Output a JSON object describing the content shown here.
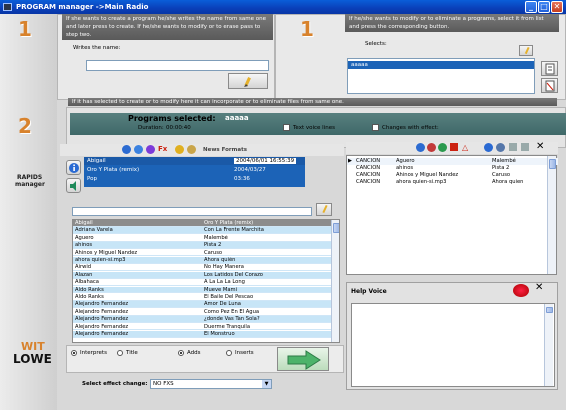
{
  "window": {
    "title": "PROGRAM manager   ->Main Radio"
  },
  "sidebar": {
    "step1": "1",
    "step2": "2",
    "brand_line1": "RAPIDS",
    "brand_line2": "manager",
    "logo_line1": "WIT",
    "logo_line2": "LOWE"
  },
  "step1_right_num": "1",
  "create_panel": {
    "instruction": "If she wants to create a program he/she writes the name from same one and later press to create. If he/she wants to modify or to erase pass to step two.",
    "name_label": "Writes the name:",
    "name_value": ""
  },
  "modify_panel": {
    "instruction": "If he/she wants to modify or to eliminate a programs, select it from list and press the corresponding button.",
    "selects_label": "Selects:",
    "selected_item": "aaaaa"
  },
  "step2_instruction": "If it has selected to create or to modify here it can incorporate or to eliminate files from same one.",
  "program_bar": {
    "title": "Programs selected:",
    "value": "aaaaa",
    "duration_label": "Duration:",
    "duration_value": "00:00:40",
    "text_voice_label": "Text voice lines",
    "changes_label": "Changes with effect:"
  },
  "library_toolbar": {
    "label": "News Formats",
    "fx_label": "Fx"
  },
  "track_info": {
    "rows": [
      {
        "title": "Abigail",
        "date": "2004/06/01 16:55:39"
      },
      {
        "title": "Oro Y Plata (remix)",
        "date": "2004/03/27"
      },
      {
        "title": "Pop",
        "date": "03:36"
      }
    ]
  },
  "filter": {
    "value": ""
  },
  "tracks": {
    "header": [
      "Abigail",
      "Oro Y Plata (remix)"
    ],
    "rows": [
      [
        "Adriana Varela",
        "Con La Frente Marchita"
      ],
      [
        "Aguero",
        "Malembé"
      ],
      [
        "ahinos",
        "Pista 2"
      ],
      [
        "Ahinos y Miguel Nandez",
        "Caruso"
      ],
      [
        "ahora quien-si.mp3",
        "Ahora quién"
      ],
      [
        "Airwid",
        "No Hay Manera"
      ],
      [
        "Alazan",
        "Los Latidos Del Corazo"
      ],
      [
        "Albahaca",
        "A La La La Long"
      ],
      [
        "Aldo Ranks",
        "Mueve Mami"
      ],
      [
        "Aldo Ranks",
        "El Baile Del Pescao"
      ],
      [
        "Alejandro Fernandez",
        "Amor De Luna"
      ],
      [
        "Alejandro Fernandez",
        "Como Pez En El Agua"
      ],
      [
        "Alejandro Fernandez",
        "¿donde Vas Tan Sola?"
      ],
      [
        "Alejandro Fernandez",
        "Duerme Tranquila"
      ],
      [
        "Alejandro Fernandez",
        "El Monstruo"
      ]
    ]
  },
  "playlist": {
    "rows": [
      [
        "CANCION",
        "Aguero",
        "Malembé"
      ],
      [
        "CANCION",
        "ahinos",
        "Pista 2"
      ],
      [
        "CANCION",
        "Ahinos y Miguel Nandez",
        "Caruso"
      ],
      [
        "CANCION",
        "ahora quien-si.mp3",
        "Ahora quien"
      ]
    ]
  },
  "help": {
    "title": "Help Voice",
    "text": ""
  },
  "options": {
    "interprets": "Interprets",
    "title": "Title",
    "adds": "Adds",
    "inserts": "Inserts",
    "selected_search": "Interprets",
    "selected_mode": "Adds"
  },
  "effect": {
    "label": "Select effect change:",
    "value": "NO FXS"
  },
  "colors": {
    "accent_orange": "#d8822c",
    "teal": "#4a7373",
    "list_blue": "#c7e5f7",
    "selection": "#1c63b7"
  }
}
